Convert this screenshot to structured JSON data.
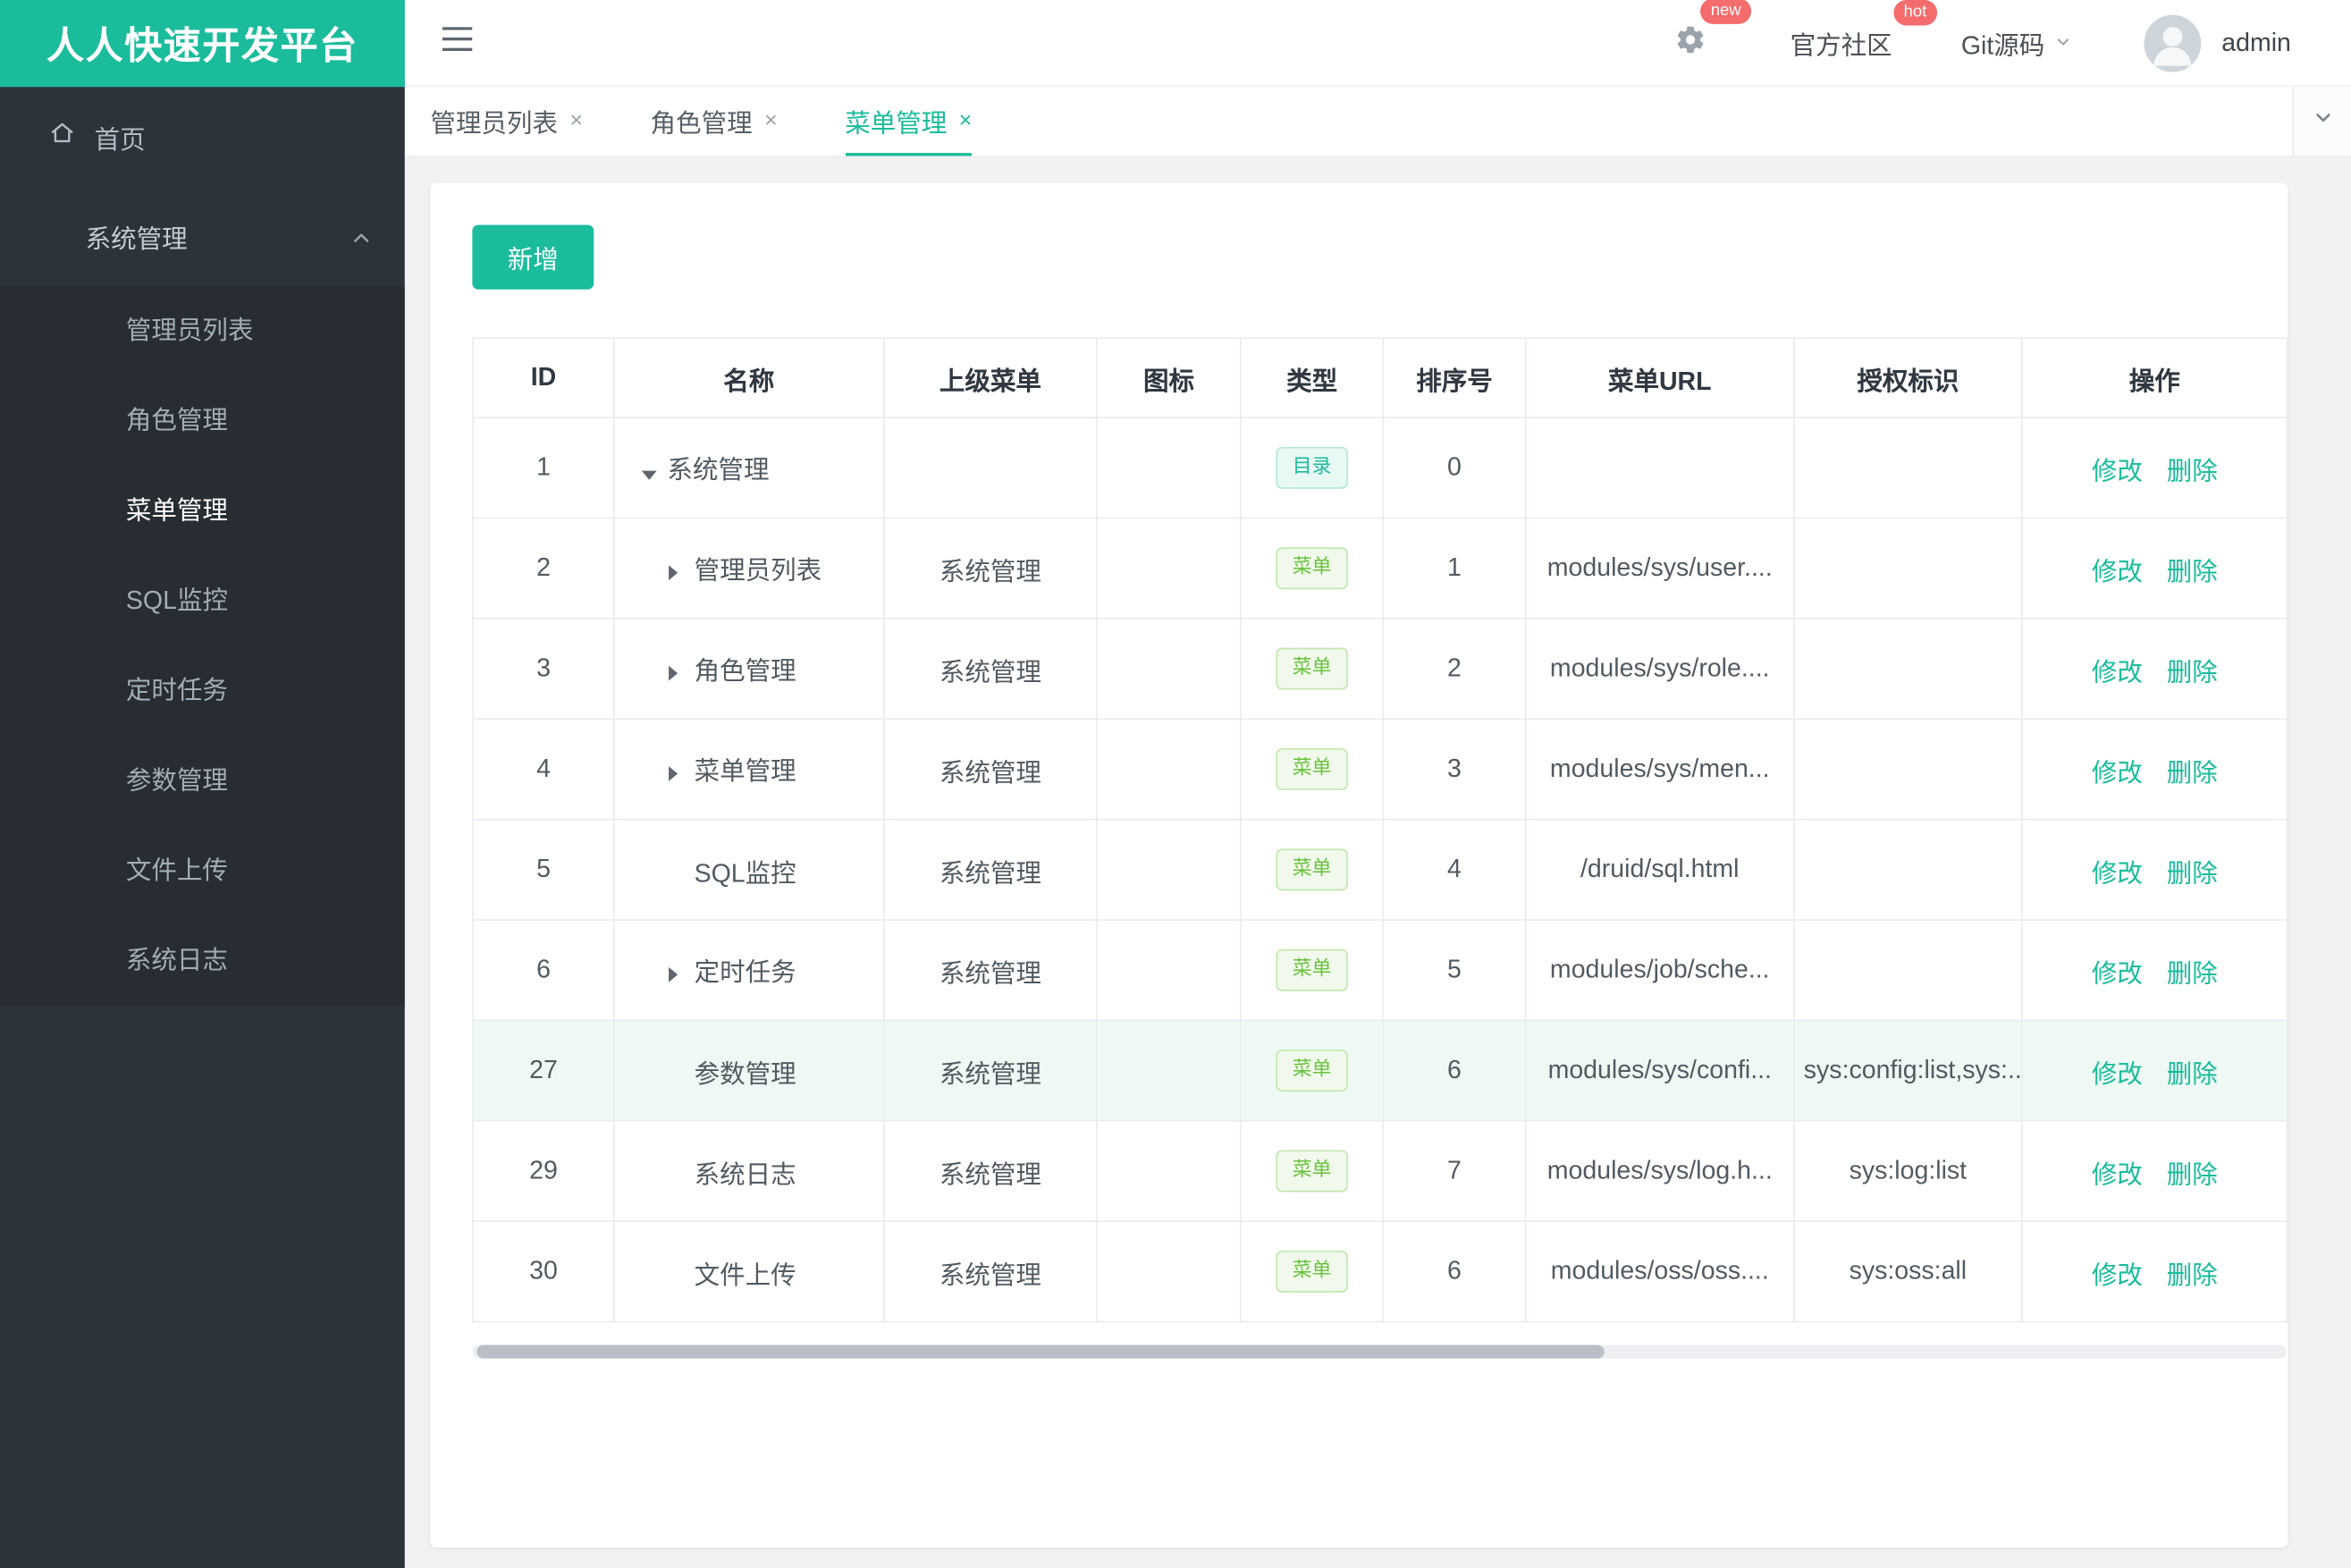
{
  "brand": {
    "title": "人人快速开发平台"
  },
  "colors": {
    "accent": "#1abc9c",
    "badge": "#f56c6c",
    "tag_menu_green": "#67c23a",
    "sidebar_bg": "#2d333a"
  },
  "topbar": {
    "settings_badge": "new",
    "community_label": "官方社区",
    "community_badge": "hot",
    "git_label": "Git源码",
    "username": "admin"
  },
  "sidebar": {
    "home_label": "首页",
    "group_label": "系统管理",
    "items": [
      "管理员列表",
      "角色管理",
      "菜单管理",
      "SQL监控",
      "定时任务",
      "参数管理",
      "文件上传",
      "系统日志"
    ],
    "active_item": "菜单管理"
  },
  "tabs": [
    "管理员列表",
    "角色管理",
    "菜单管理"
  ],
  "active_tab": "菜单管理",
  "toolbar": {
    "add_label": "新增"
  },
  "table": {
    "columns": [
      "ID",
      "名称",
      "上级菜单",
      "图标",
      "类型",
      "排序号",
      "菜单URL",
      "授权标识",
      "操作"
    ],
    "actions": {
      "edit": "修改",
      "delete": "删除"
    },
    "rows": [
      {
        "id": "1",
        "name": "系统管理",
        "parent": "",
        "icon": "",
        "type": "目录",
        "order": "0",
        "url": "",
        "perms": ""
      },
      {
        "id": "2",
        "name": "管理员列表",
        "parent": "系统管理",
        "icon": "",
        "type": "菜单",
        "order": "1",
        "url": "modules/sys/user....",
        "perms": ""
      },
      {
        "id": "3",
        "name": "角色管理",
        "parent": "系统管理",
        "icon": "",
        "type": "菜单",
        "order": "2",
        "url": "modules/sys/role....",
        "perms": ""
      },
      {
        "id": "4",
        "name": "菜单管理",
        "parent": "系统管理",
        "icon": "",
        "type": "菜单",
        "order": "3",
        "url": "modules/sys/men...",
        "perms": ""
      },
      {
        "id": "5",
        "name": "SQL监控",
        "parent": "系统管理",
        "icon": "",
        "type": "菜单",
        "order": "4",
        "url": "/druid/sql.html",
        "perms": ""
      },
      {
        "id": "6",
        "name": "定时任务",
        "parent": "系统管理",
        "icon": "",
        "type": "菜单",
        "order": "5",
        "url": "modules/job/sche...",
        "perms": ""
      },
      {
        "id": "27",
        "name": "参数管理",
        "parent": "系统管理",
        "icon": "",
        "type": "菜单",
        "order": "6",
        "url": "modules/sys/confi...",
        "perms": "sys:config:list,sys:..."
      },
      {
        "id": "29",
        "name": "系统日志",
        "parent": "系统管理",
        "icon": "",
        "type": "菜单",
        "order": "7",
        "url": "modules/sys/log.h...",
        "perms": "sys:log:list"
      },
      {
        "id": "30",
        "name": "文件上传",
        "parent": "系统管理",
        "icon": "",
        "type": "菜单",
        "order": "6",
        "url": "modules/oss/oss....",
        "perms": "sys:oss:all"
      }
    ]
  }
}
